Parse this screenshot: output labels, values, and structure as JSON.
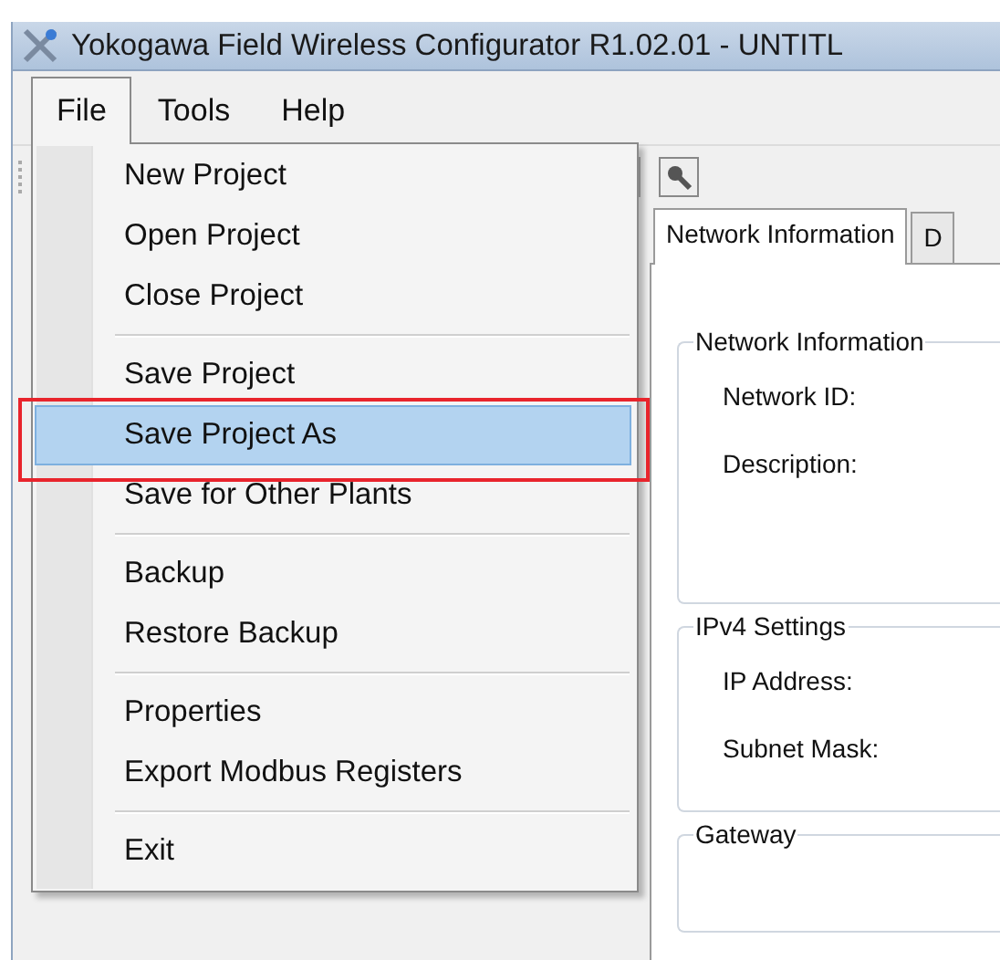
{
  "window": {
    "title": "Yokogawa Field Wireless Configurator R1.02.01 - UNTITL"
  },
  "menu_bar": [
    {
      "label": "File",
      "selected": true
    },
    {
      "label": "Tools",
      "selected": false
    },
    {
      "label": "Help",
      "selected": false
    }
  ],
  "file_menu": [
    [
      {
        "label": "New Project",
        "highlighted": false,
        "annotated": false
      },
      {
        "label": "Open Project",
        "highlighted": false,
        "annotated": false
      },
      {
        "label": "Close Project",
        "highlighted": false,
        "annotated": false
      }
    ],
    [
      {
        "label": "Save Project",
        "highlighted": false,
        "annotated": false
      },
      {
        "label": "Save Project As",
        "highlighted": true,
        "annotated": true
      },
      {
        "label": "Save for Other Plants",
        "highlighted": false,
        "annotated": false
      }
    ],
    [
      {
        "label": "Backup",
        "highlighted": false,
        "annotated": false
      },
      {
        "label": "Restore Backup",
        "highlighted": false,
        "annotated": false
      }
    ],
    [
      {
        "label": "Properties",
        "highlighted": false,
        "annotated": false
      },
      {
        "label": "Export Modbus Registers",
        "highlighted": false,
        "annotated": false
      }
    ],
    [
      {
        "label": "Exit",
        "highlighted": false,
        "annotated": false
      }
    ]
  ],
  "tabs": [
    {
      "label": "Network Information",
      "selected": true
    },
    {
      "label": "D",
      "selected": false
    }
  ],
  "groups": [
    {
      "title": "Network Information",
      "fields": [
        "Network ID:",
        "Description:"
      ]
    },
    {
      "title": "IPv4 Settings",
      "fields": [
        "IP Address:",
        "Subnet Mask:"
      ]
    },
    {
      "title": "Gateway"
    }
  ]
}
